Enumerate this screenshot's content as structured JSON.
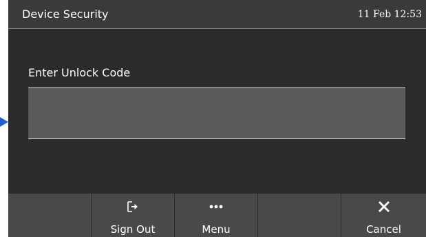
{
  "header": {
    "title": "Device Security",
    "datetime": "11 Feb 12:53"
  },
  "unlock": {
    "prompt": "Enter Unlock Code",
    "value": "",
    "placeholder": ""
  },
  "softkeys": [
    {
      "label": "",
      "icon": ""
    },
    {
      "label": "Sign Out",
      "icon": "sign-out-icon"
    },
    {
      "label": "Menu",
      "icon": "more-dots-icon"
    },
    {
      "label": "",
      "icon": ""
    },
    {
      "label": "Cancel",
      "icon": "close-icon"
    }
  ],
  "colors": {
    "background": "#2b2b2d",
    "header_accent": "#3b9cc4",
    "input_fill": "#5a5a58",
    "softkey_fill": "#49494b",
    "focus_arrow": "#1f5fd4"
  }
}
